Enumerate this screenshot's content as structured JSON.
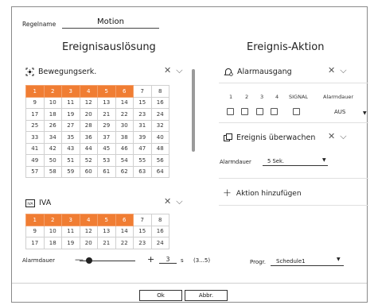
{
  "rule": {
    "label": "Regelname",
    "value": "Motion"
  },
  "left": {
    "title": "Ereignisauslösung",
    "sections": [
      {
        "name": "Bewegungserk.",
        "channels": [
          1,
          2,
          3,
          4,
          5,
          6,
          7,
          8,
          9,
          10,
          11,
          12,
          13,
          14,
          15,
          16,
          17,
          18,
          19,
          20,
          21,
          22,
          23,
          24,
          25,
          26,
          27,
          28,
          29,
          30,
          31,
          32,
          33,
          34,
          35,
          36,
          37,
          38,
          39,
          40,
          41,
          42,
          43,
          44,
          45,
          46,
          47,
          48,
          49,
          50,
          51,
          52,
          53,
          54,
          55,
          56,
          57,
          58,
          59,
          60,
          61,
          62,
          63,
          64
        ],
        "selected": [
          1,
          2,
          3,
          4,
          5,
          6
        ]
      },
      {
        "name": "IVA",
        "channels": [
          1,
          2,
          3,
          4,
          5,
          6,
          7,
          8,
          9,
          10,
          11,
          12,
          13,
          14,
          15,
          16,
          17,
          18,
          19,
          20,
          21,
          22,
          23,
          24
        ],
        "selected": [
          1,
          2,
          3,
          4,
          5,
          6
        ]
      }
    ],
    "alarm_duration": {
      "label": "Alarmdauer",
      "value": "3",
      "unit": "s",
      "range": "(3...5)",
      "level": 0.0
    }
  },
  "right": {
    "title": "Ereignis-Aktion",
    "alarm_out": {
      "name": "Alarmausgang",
      "columns": [
        "1",
        "2",
        "3",
        "4",
        "SIGNAL",
        "Alarmdauer"
      ],
      "duration_value": "AUS"
    },
    "monitor": {
      "name": "Ereignis überwachen",
      "duration_label": "Alarmdauer",
      "duration_value": "5 Sek."
    },
    "add_action": "Aktion hinzufügen",
    "program": {
      "label": "Progr.",
      "value": "Schedule1"
    }
  },
  "buttons": {
    "ok": "Ok",
    "cancel": "Abbr."
  },
  "colors": {
    "accent": "#f07d33"
  },
  "icons": {
    "motion": "motion-detect-icon",
    "iva": "iva-icon",
    "alarm": "alarm-bell-icon",
    "monitor": "monitor-icon",
    "close": "close-icon",
    "chevron": "chevron-down-icon",
    "add": "plus-icon"
  }
}
